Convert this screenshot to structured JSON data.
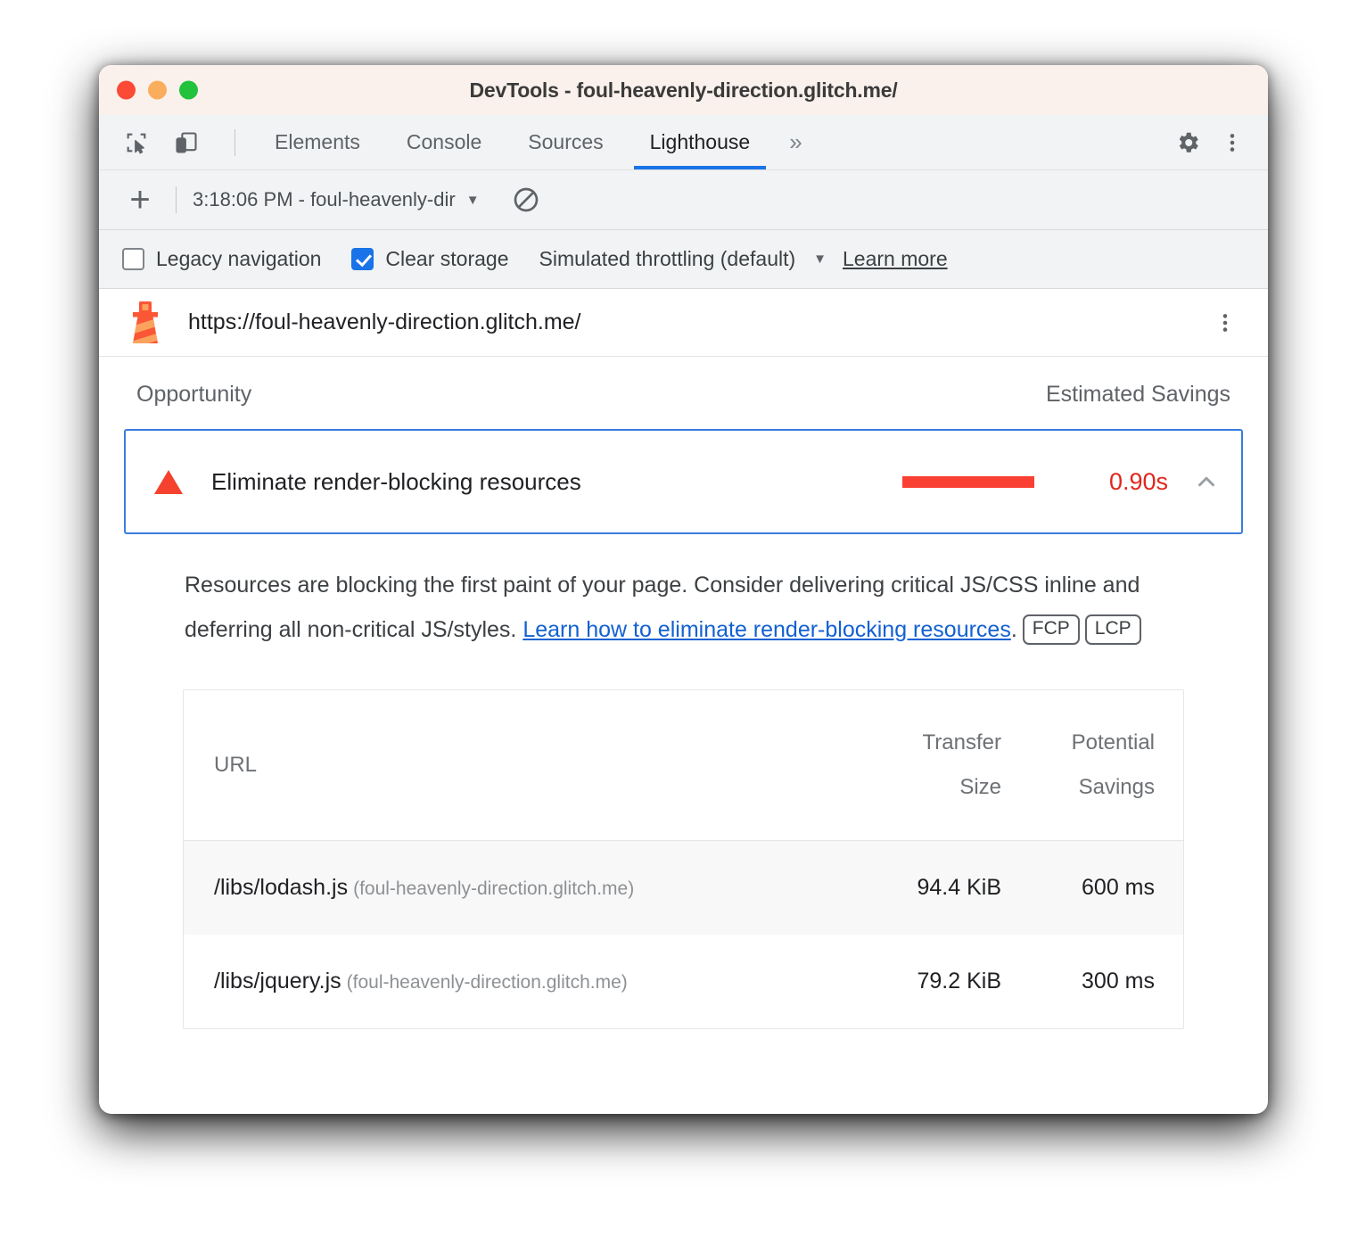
{
  "window": {
    "title": "DevTools - foul-heavenly-direction.glitch.me/",
    "traffic_lights": [
      "close",
      "minimize",
      "maximize"
    ],
    "colors": {
      "close": "#fb4a35",
      "minimize": "#fbad5e",
      "maximize": "#22c23c",
      "titlebar_bg": "#fbf1ec",
      "accent_blue": "#1a73e8",
      "error_red": "#f4422e",
      "value_red": "#e1261c",
      "link_blue": "#1261d2"
    }
  },
  "tabbar": {
    "icons": [
      {
        "name": "inspect-element-icon"
      },
      {
        "name": "device-toolbar-icon"
      }
    ],
    "tabs": [
      {
        "label": "Elements",
        "active": false
      },
      {
        "label": "Console",
        "active": false
      },
      {
        "label": "Sources",
        "active": false
      },
      {
        "label": "Lighthouse",
        "active": true
      }
    ],
    "more_tabs": "»",
    "settings_icon": "gear-icon",
    "menu_icon": "kebab-menu-icon"
  },
  "lighthouse_toolbar": {
    "new_report_label": "+",
    "report_select_value": "3:18:06 PM - foul-heavenly-dir",
    "caret": "▼",
    "clear_icon": "no-entry-icon"
  },
  "options": {
    "legacy_navigation": {
      "label": "Legacy navigation",
      "checked": false
    },
    "clear_storage": {
      "label": "Clear storage",
      "checked": true
    },
    "throttling": {
      "label": "Simulated throttling (default)",
      "caret": "▼"
    },
    "learn_more": "Learn more"
  },
  "report": {
    "logo_icon": "lighthouse-icon",
    "url": "https://foul-heavenly-direction.glitch.me/",
    "menu_icon": "kebab-menu-icon",
    "columns": {
      "opportunity": "Opportunity",
      "estimated_savings": "Estimated Savings"
    },
    "opportunity": {
      "severity_icon": "warning-triangle-icon",
      "title": "Eliminate render-blocking resources",
      "savings_value": "0.90s",
      "bar_fill_ratio": 0.51,
      "expanded": true,
      "collapse_icon": "chevron-up-icon",
      "description_part1": "Resources are blocking the first paint of your page. Consider delivering critical JS/CSS inline and deferring all non-critical JS/styles. ",
      "description_link": "Learn how to eliminate render-blocking resources",
      "description_part2": ".",
      "metric_badges": [
        "FCP",
        "LCP"
      ]
    },
    "table": {
      "headers": {
        "url": "URL",
        "transfer_size_line1": "Transfer",
        "transfer_size_line2": "Size",
        "potential_savings_line1": "Potential",
        "potential_savings_line2": "Savings"
      },
      "rows": [
        {
          "url": "/libs/lodash.js",
          "origin": "(foul-heavenly-direction.glitch.me)",
          "transfer_size": "94.4 KiB",
          "potential_savings": "600 ms"
        },
        {
          "url": "/libs/jquery.js",
          "origin": "(foul-heavenly-direction.glitch.me)",
          "transfer_size": "79.2 KiB",
          "potential_savings": "300 ms"
        }
      ]
    }
  }
}
